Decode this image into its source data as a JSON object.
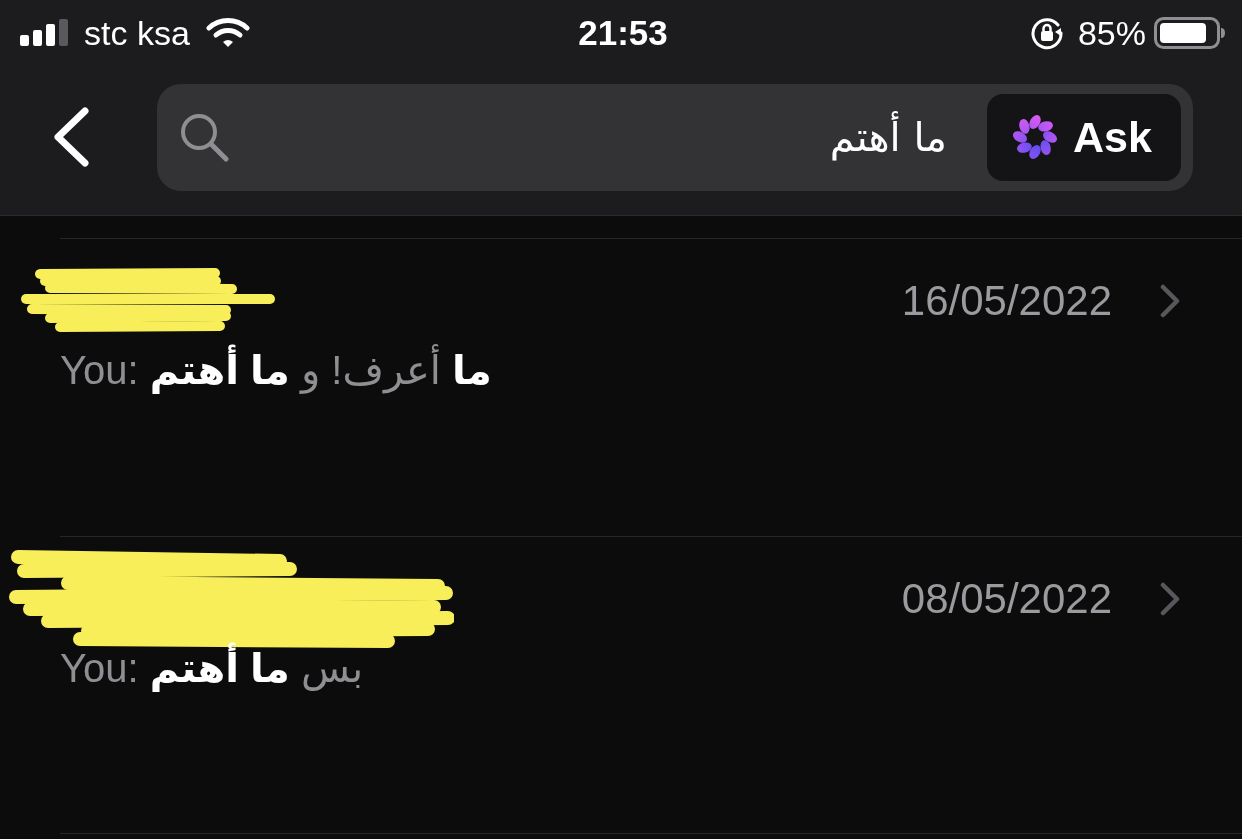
{
  "status_bar": {
    "carrier": "stc ksa",
    "time": "21:53",
    "battery": "85%"
  },
  "search": {
    "value": "ما أهتم",
    "ask_button": "Ask"
  },
  "results": [
    {
      "name_redacted": true,
      "date": "16/05/2022",
      "preview": "You: **ما** أعرف! و **ما أهتم**"
    },
    {
      "name_redacted": true,
      "date": "08/05/2022",
      "preview": "You: بس **ما أهتم**"
    }
  ]
}
